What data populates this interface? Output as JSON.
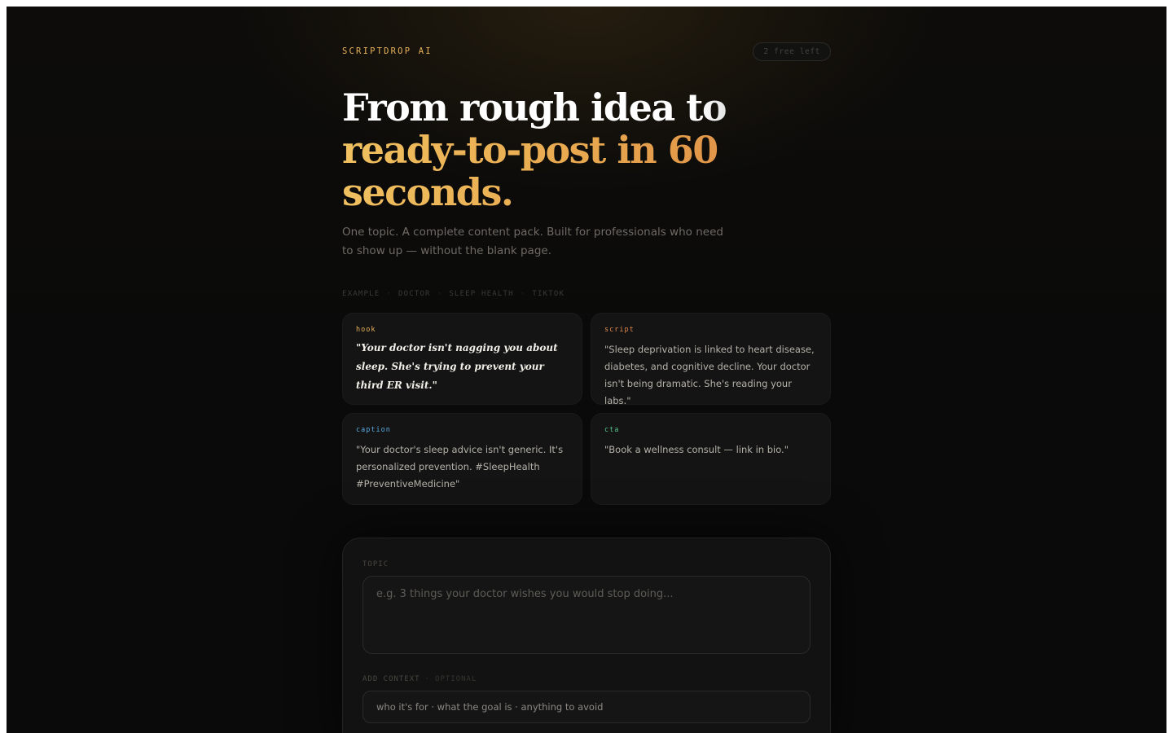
{
  "header": {
    "brand": "SCRIPTDROP AI",
    "credits_badge": "2 free left"
  },
  "hero": {
    "headline_line1": "From rough idea to",
    "headline_line2": "ready-to-post in 60",
    "headline_line3": "seconds.",
    "subtitle": "One topic. A complete content pack. Built for professionals who need to show up — without the blank page."
  },
  "example": {
    "label_parts": [
      "EXAMPLE",
      "DOCTOR",
      "SLEEP HEALTH",
      "TIKTOK"
    ],
    "separator": "·",
    "cards": {
      "hook": {
        "tag": "hook",
        "text": "\"Your doctor isn't nagging you about sleep. She's trying to prevent your third ER visit.\""
      },
      "script": {
        "tag": "script",
        "text": "\"Sleep deprivation is linked to heart disease, diabetes, and cognitive decline. Your doctor isn't being dramatic. She's reading your labs.\""
      },
      "caption": {
        "tag": "caption",
        "text": "\"Your doctor's sleep advice isn't generic. It's personalized prevention. #SleepHealth #PreventiveMedicine\""
      },
      "cta": {
        "tag": "cta",
        "text": "\"Book a wellness consult — link in bio.\""
      }
    }
  },
  "form": {
    "topic_label": "TOPIC",
    "topic_placeholder": "e.g. 3 things your doctor wishes you would stop doing...",
    "context_label": "ADD CONTEXT",
    "context_optional": "OPTIONAL",
    "context_placeholder": "who it's for · what the goal is · anything to avoid"
  },
  "colors": {
    "accent_gold": "#e7b25a",
    "accent_orange": "#e2894f",
    "caption_blue": "#5aa9de",
    "cta_green": "#57c48a",
    "background": "#0a0a0a"
  }
}
